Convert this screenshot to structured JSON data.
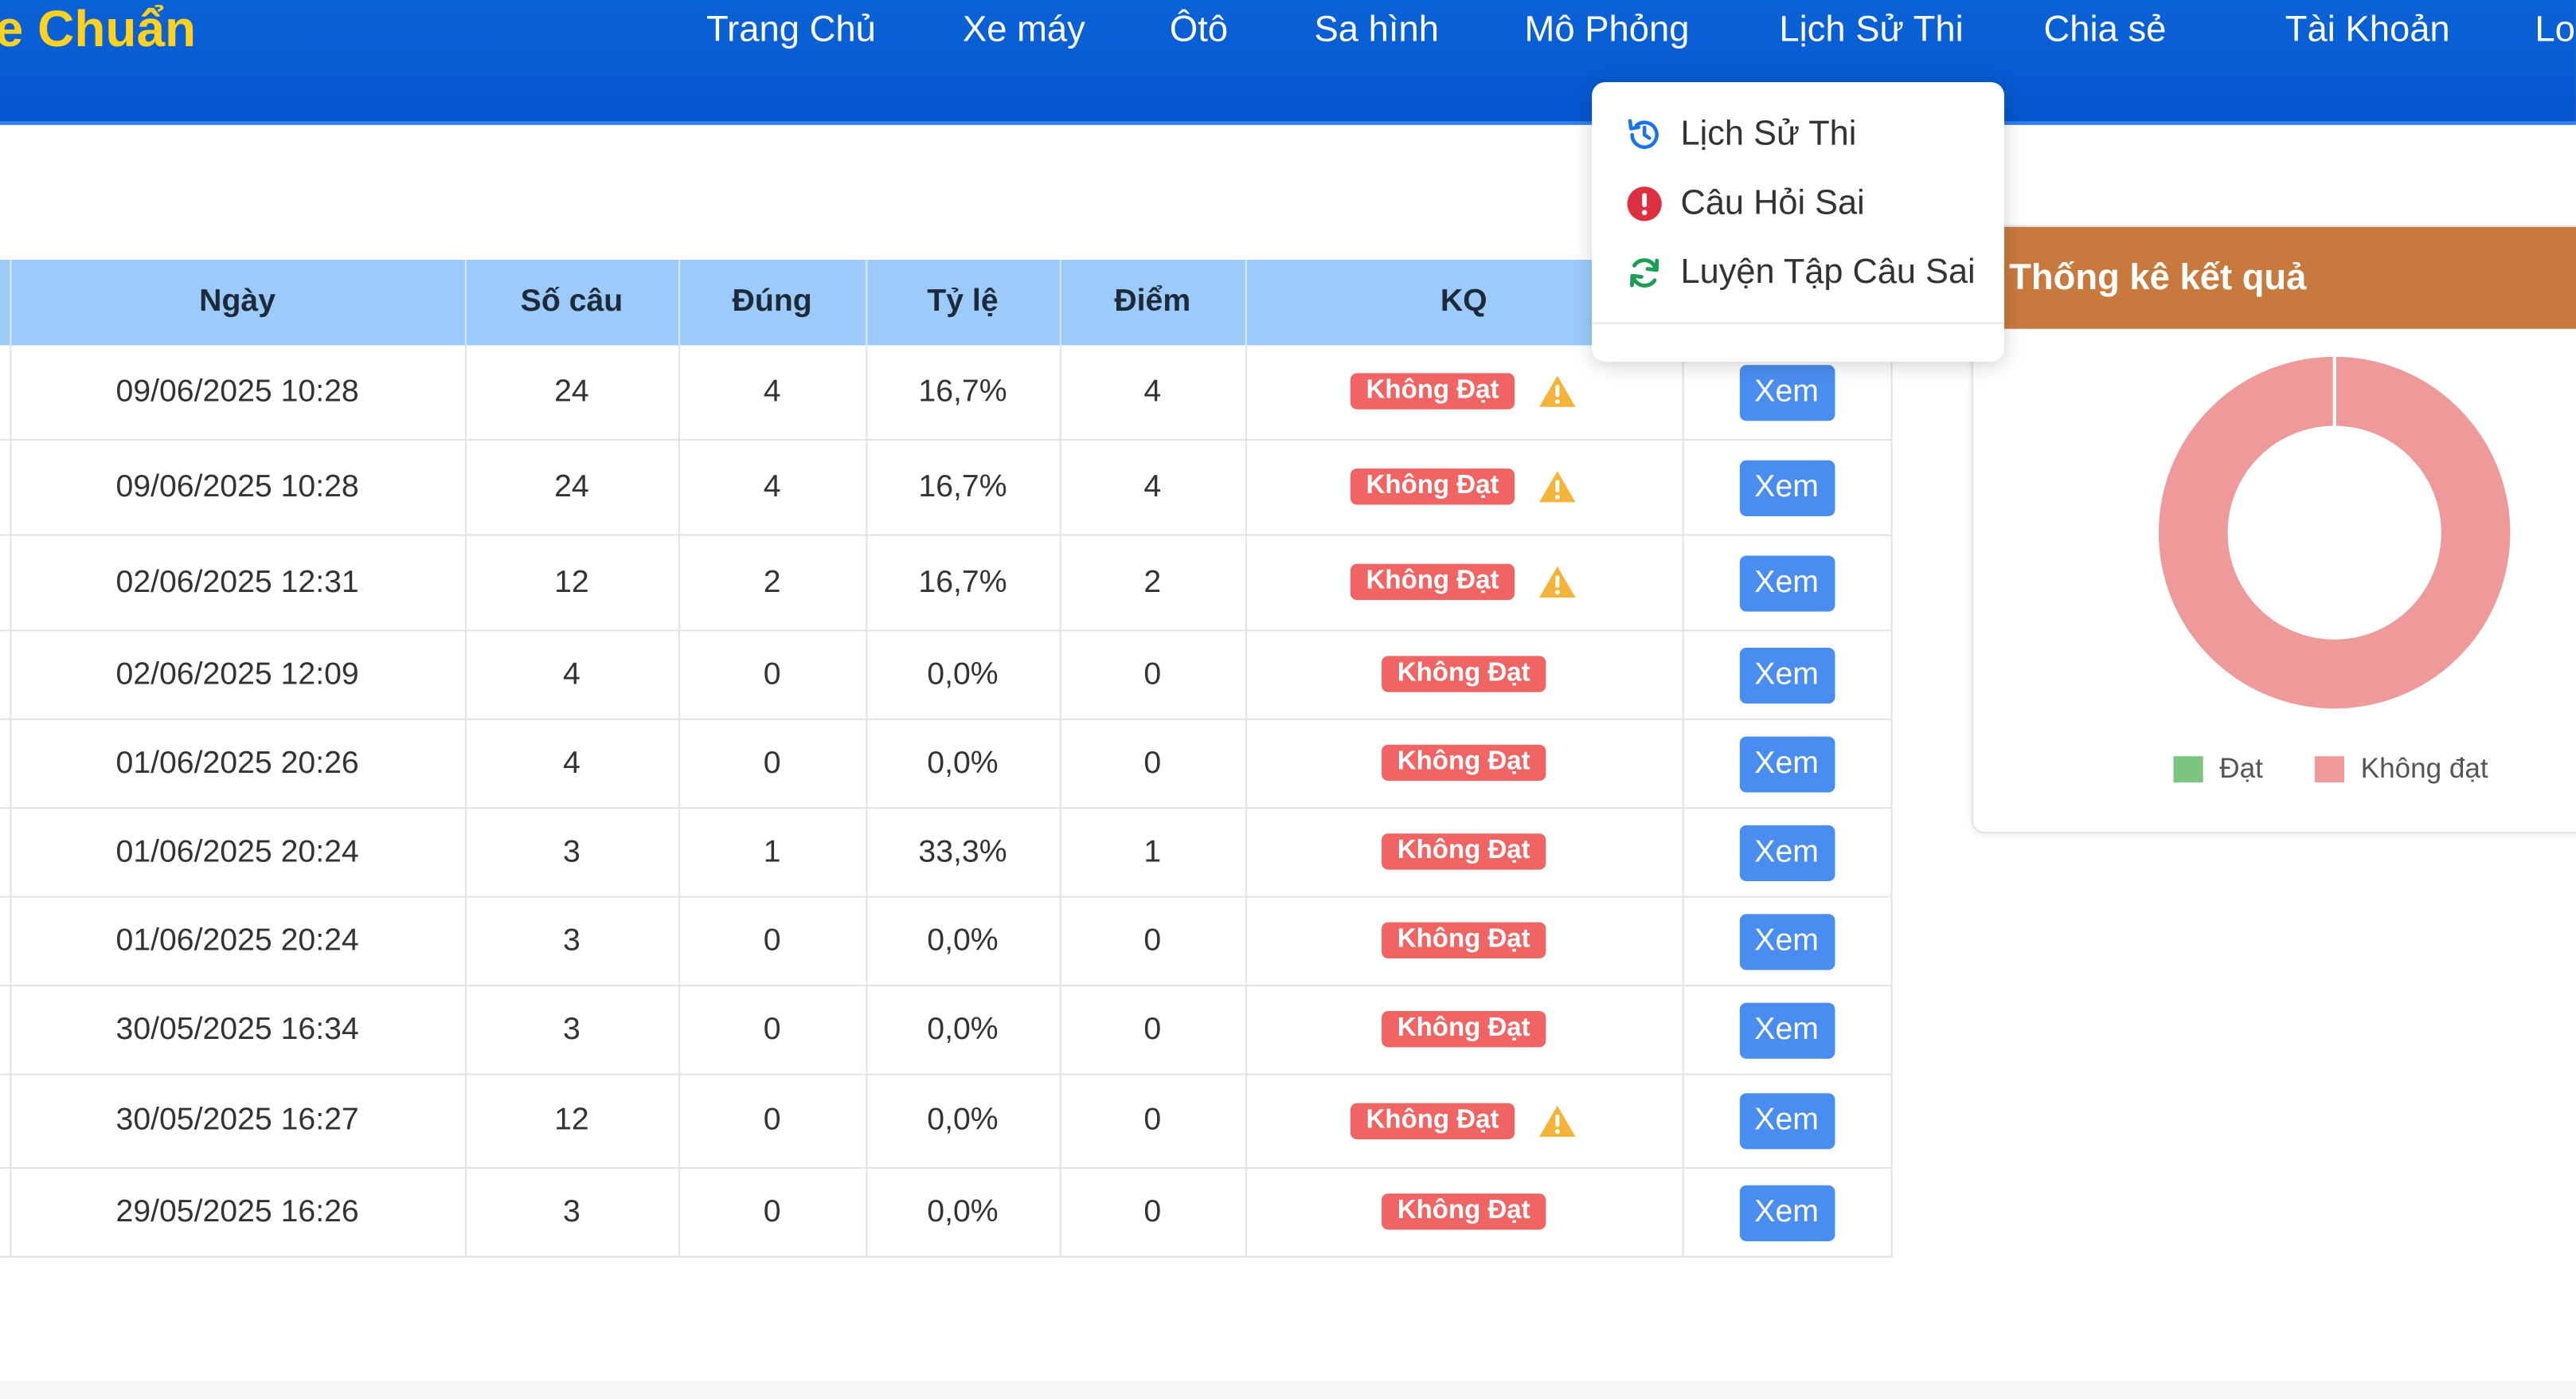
{
  "brand": "e Chuẩn",
  "nav": [
    "Trang Chủ",
    "Xe máy",
    "Ôtô",
    "Sa hình",
    "Mô Phỏng",
    "Lịch Sử Thi",
    "Chia sẻ",
    "Tài Khoản",
    "Lo"
  ],
  "dropdown": {
    "items": [
      {
        "label": "Lịch Sử Thi",
        "icon": "history-icon"
      },
      {
        "label": "Câu Hỏi Sai",
        "icon": "exclamation-circle-icon"
      },
      {
        "label": "Luyện Tập Câu Sai",
        "icon": "refresh-icon"
      }
    ]
  },
  "table": {
    "headers": [
      "Ngày",
      "Số câu",
      "Đúng",
      "Tỷ lệ",
      "Điểm",
      "KQ",
      ""
    ],
    "rows": [
      {
        "date": "09/06/2025 10:28",
        "count": "24",
        "correct": "4",
        "rate": "16,7%",
        "score": "4",
        "result": "Không Đạt",
        "warning": true,
        "action": "Xem"
      },
      {
        "date": "09/06/2025 10:28",
        "count": "24",
        "correct": "4",
        "rate": "16,7%",
        "score": "4",
        "result": "Không Đạt",
        "warning": true,
        "action": "Xem"
      },
      {
        "date": "02/06/2025 12:31",
        "count": "12",
        "correct": "2",
        "rate": "16,7%",
        "score": "2",
        "result": "Không Đạt",
        "warning": true,
        "action": "Xem"
      },
      {
        "date": "02/06/2025 12:09",
        "count": "4",
        "correct": "0",
        "rate": "0,0%",
        "score": "0",
        "result": "Không Đạt",
        "warning": false,
        "action": "Xem"
      },
      {
        "date": "01/06/2025 20:26",
        "count": "4",
        "correct": "0",
        "rate": "0,0%",
        "score": "0",
        "result": "Không Đạt",
        "warning": false,
        "action": "Xem"
      },
      {
        "date": "01/06/2025 20:24",
        "count": "3",
        "correct": "1",
        "rate": "33,3%",
        "score": "1",
        "result": "Không Đạt",
        "warning": false,
        "action": "Xem"
      },
      {
        "date": "01/06/2025 20:24",
        "count": "3",
        "correct": "0",
        "rate": "0,0%",
        "score": "0",
        "result": "Không Đạt",
        "warning": false,
        "action": "Xem"
      },
      {
        "date": "30/05/2025 16:34",
        "count": "3",
        "correct": "0",
        "rate": "0,0%",
        "score": "0",
        "result": "Không Đạt",
        "warning": false,
        "action": "Xem"
      },
      {
        "date": "30/05/2025 16:27",
        "count": "12",
        "correct": "0",
        "rate": "0,0%",
        "score": "0",
        "result": "Không Đạt",
        "warning": true,
        "action": "Xem"
      },
      {
        "date": "29/05/2025 16:26",
        "count": "3",
        "correct": "0",
        "rate": "0,0%",
        "score": "0",
        "result": "Không Đạt",
        "warning": false,
        "action": "Xem"
      }
    ]
  },
  "stats": {
    "title": "Thống kê kết quả",
    "legend": [
      {
        "label": "Đạt",
        "color": "#7cc47f"
      },
      {
        "label": "Không đạt",
        "color": "#ee9a9a"
      }
    ],
    "donut": {
      "pass": 0,
      "fail": 10
    }
  },
  "colors": {
    "header": "#0656cf",
    "brand": "#ffd21f",
    "table_header": "#9ccbfb",
    "badge_fail": "#f06464",
    "view_button": "#4a8df0",
    "card_header": "#c87a3e"
  }
}
